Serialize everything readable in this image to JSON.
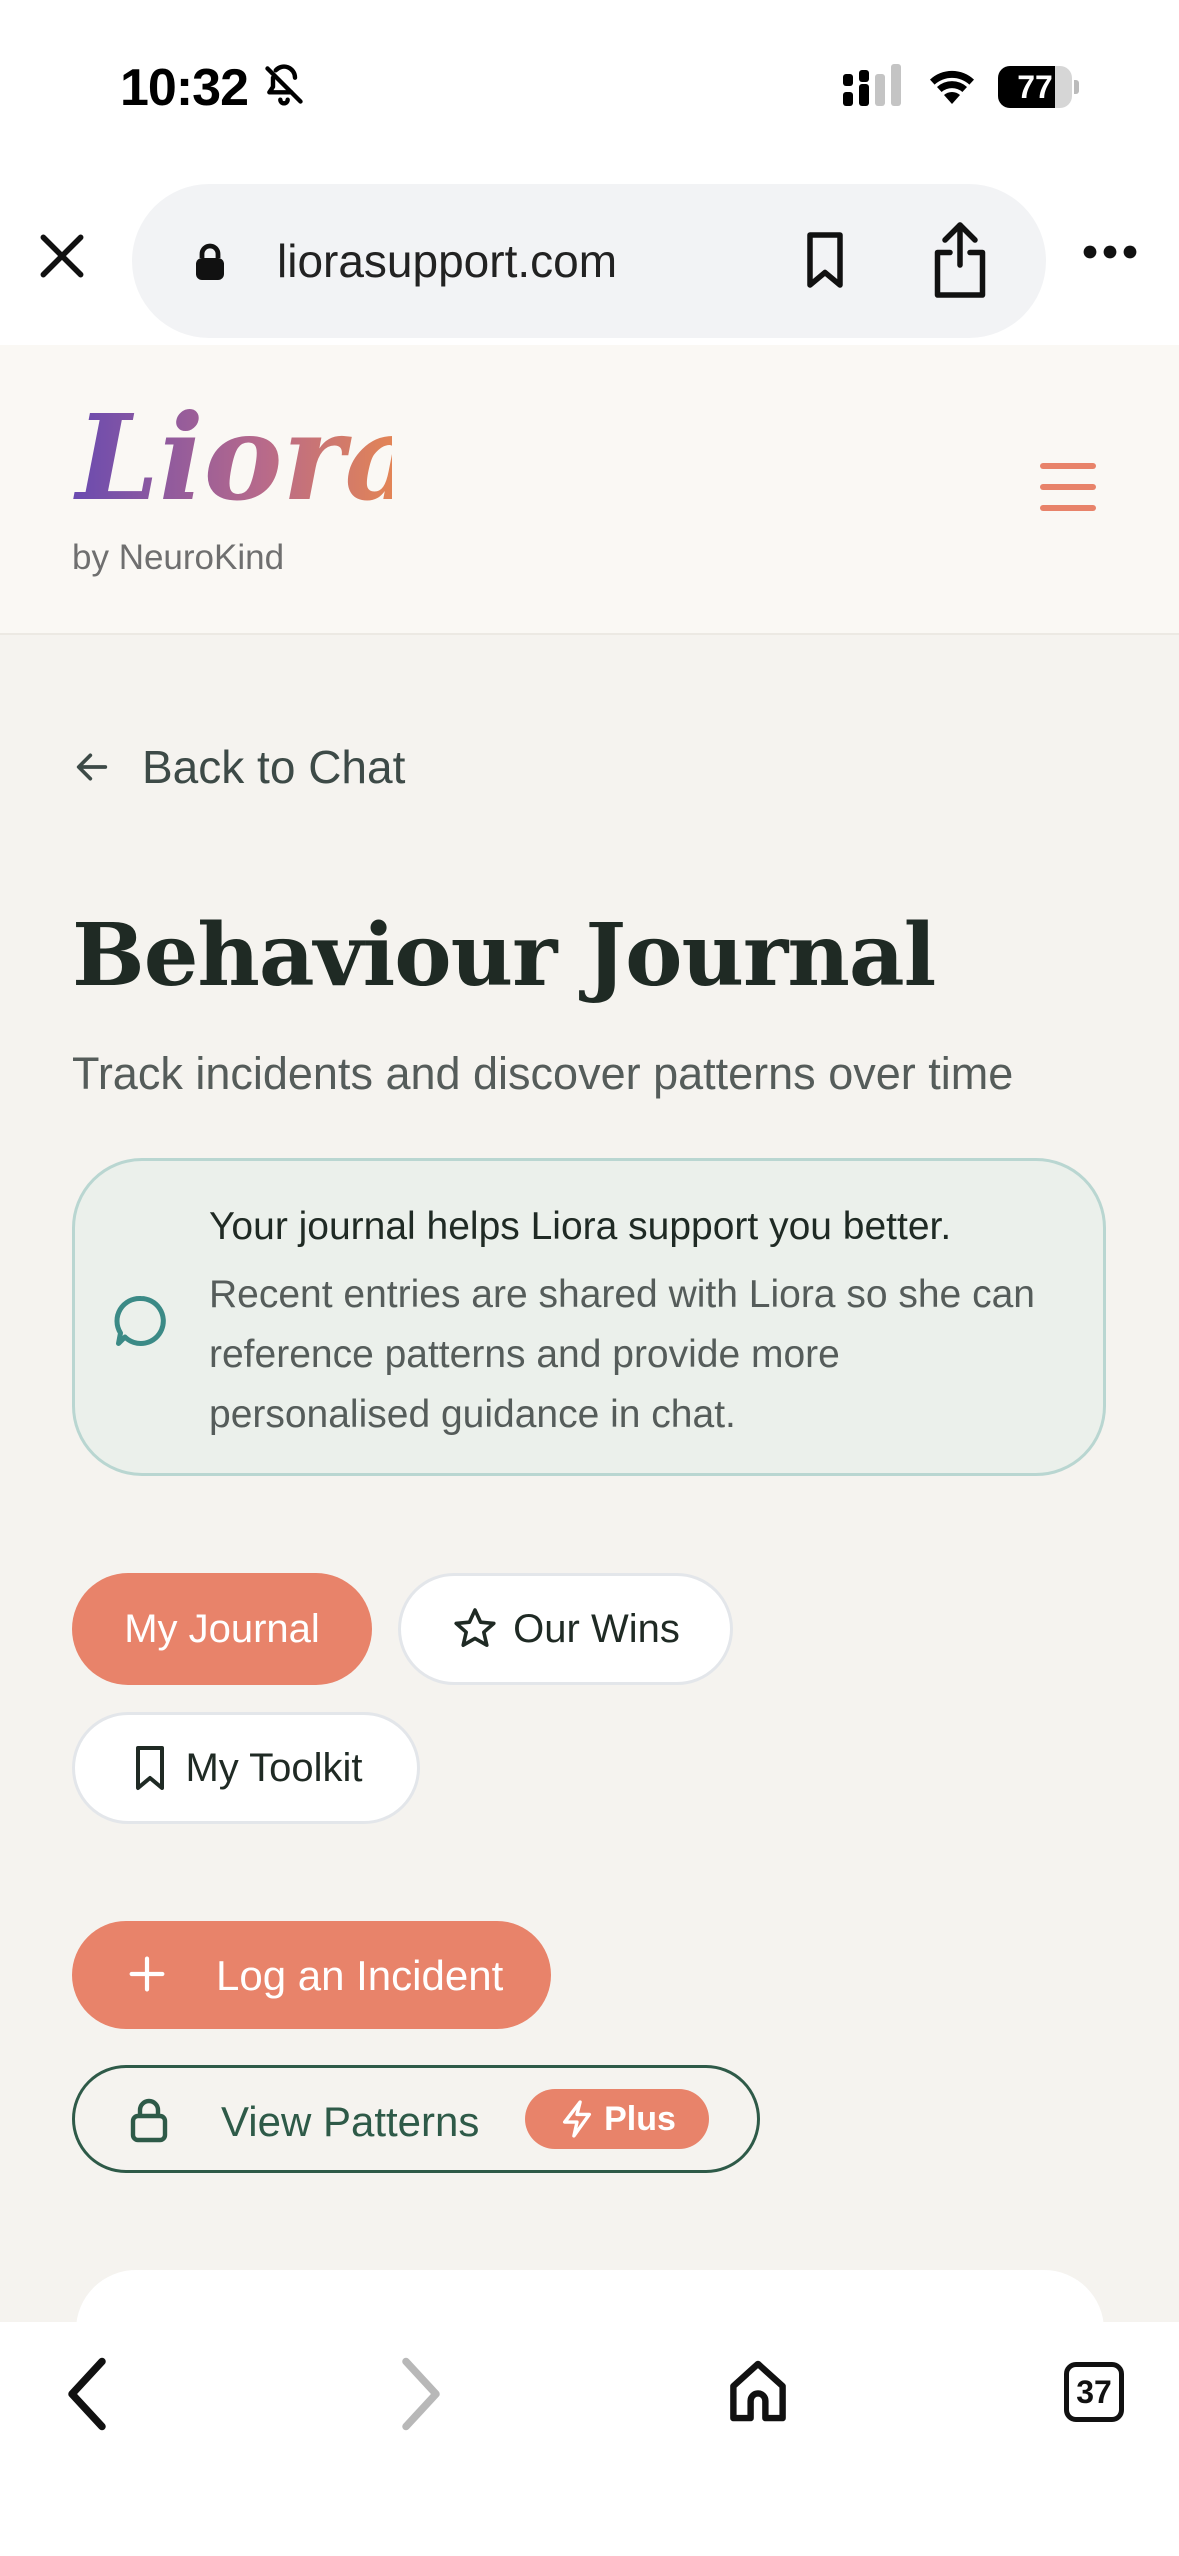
{
  "status_bar": {
    "time": "10:32",
    "battery": "77",
    "battery_level": 0.77
  },
  "browser": {
    "url": "liorasupport.com",
    "tab_count": "37"
  },
  "site": {
    "logo_text": "Liora",
    "byline": "by NeuroKind"
  },
  "page": {
    "back_label": "Back to Chat",
    "title": "Behaviour Journal",
    "subtitle": "Track incidents and discover patterns over time"
  },
  "info": {
    "heading": "Your journal helps Liora support you better.",
    "body": "Recent entries are shared with Liora so she can reference patterns and provide more personalised guidance in chat."
  },
  "tabs": [
    {
      "label": "My Journal",
      "active": true
    },
    {
      "label": "Our Wins",
      "active": false
    },
    {
      "label": "My Toolkit",
      "active": false
    }
  ],
  "actions": {
    "log_incident": "Log an Incident",
    "view_patterns": "View Patterns",
    "plus_badge": "Plus"
  },
  "colors": {
    "accent": "#e8836a",
    "dark_green": "#2e5a48",
    "teal_icon": "#3b8a86",
    "background": "#f5f3ef"
  }
}
